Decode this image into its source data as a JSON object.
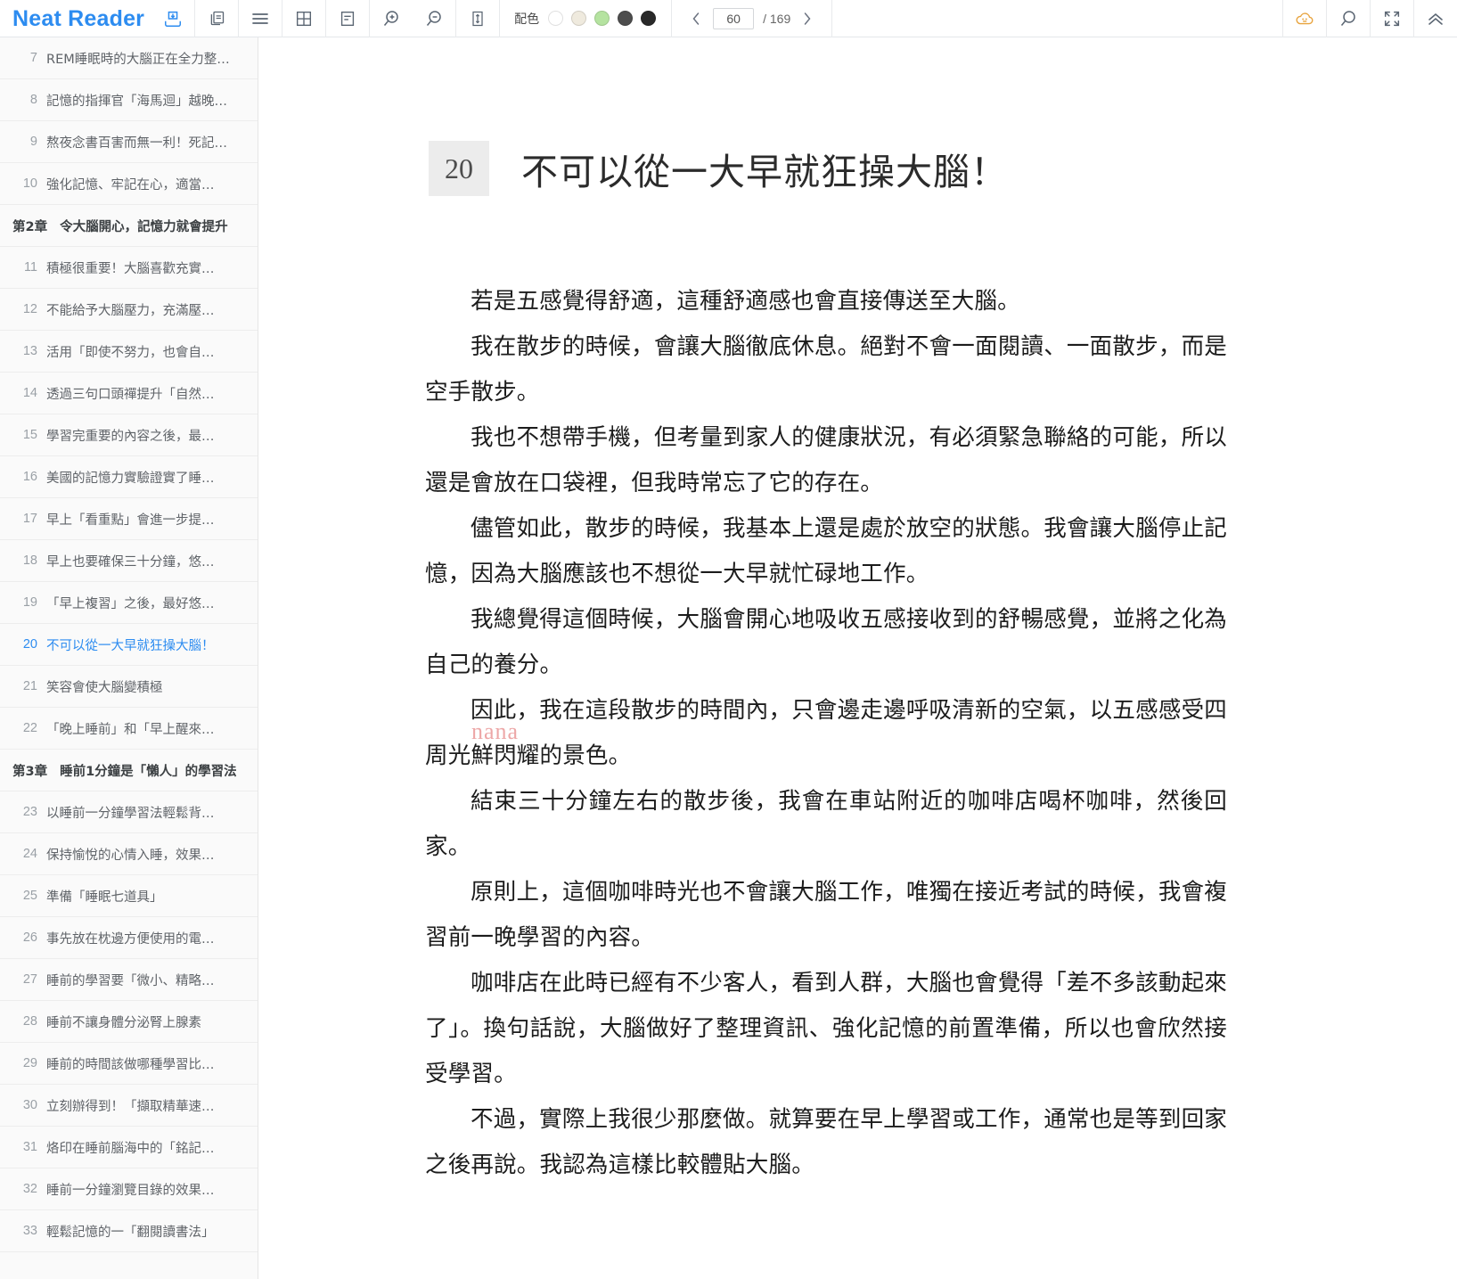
{
  "app": {
    "brand": "Neat Reader"
  },
  "toolbar": {
    "icons": [
      {
        "name": "save-to-bookshelf-icon",
        "title": "保存"
      },
      {
        "name": "copy-icon",
        "title": "複製"
      },
      {
        "name": "menu-icon",
        "title": "目錄"
      },
      {
        "name": "grid-layout-icon",
        "title": "版面"
      },
      {
        "name": "note-icon",
        "title": "筆記"
      },
      {
        "name": "zoom-in-icon",
        "title": "放大"
      },
      {
        "name": "zoom-out-icon",
        "title": "縮小"
      },
      {
        "name": "line-height-icon",
        "title": "行距"
      }
    ],
    "colors_label": "配色",
    "swatches": [
      {
        "name": "theme-white",
        "hex": "#ffffff"
      },
      {
        "name": "theme-cream",
        "hex": "#efeade"
      },
      {
        "name": "theme-green",
        "hex": "#b5e3a0"
      },
      {
        "name": "theme-dark-gray",
        "hex": "#4d4d4d"
      },
      {
        "name": "theme-black",
        "hex": "#292929"
      }
    ],
    "pager": {
      "prev_label": "‹",
      "current_page": "60",
      "total_label": "/ 169"
    },
    "right_icons": [
      {
        "name": "cloud-sync-icon",
        "title": "雲端"
      },
      {
        "name": "search-icon",
        "title": "搜尋"
      },
      {
        "name": "fullscreen-icon",
        "title": "全螢幕"
      },
      {
        "name": "collapse-toolbar-icon",
        "title": "收起"
      }
    ]
  },
  "sidebar": {
    "items": [
      {
        "type": "item",
        "num": "7",
        "label": "REM睡眠時的大腦正在全力整…",
        "active": false
      },
      {
        "type": "item",
        "num": "8",
        "label": "記憶的指揮官「海馬迴」越晚…",
        "active": false
      },
      {
        "type": "item",
        "num": "9",
        "label": "熬夜念書百害而無一利！死記…",
        "active": false
      },
      {
        "type": "item",
        "num": "10",
        "label": "強化記憶、牢記在心，適當…",
        "active": false
      },
      {
        "type": "chapter",
        "num": "第2章",
        "label": "令大腦開心，記憶力就會提升"
      },
      {
        "type": "item",
        "num": "11",
        "label": "積極很重要！大腦喜歡充實…",
        "active": false
      },
      {
        "type": "item",
        "num": "12",
        "label": "不能給予大腦壓力，充滿壓…",
        "active": false
      },
      {
        "type": "item",
        "num": "13",
        "label": "活用「即使不努力，也會自…",
        "active": false
      },
      {
        "type": "item",
        "num": "14",
        "label": "透過三句口頭禪提升「自然…",
        "active": false
      },
      {
        "type": "item",
        "num": "15",
        "label": "學習完重要的內容之後，最…",
        "active": false
      },
      {
        "type": "item",
        "num": "16",
        "label": "美國的記憶力實驗證實了睡…",
        "active": false
      },
      {
        "type": "item",
        "num": "17",
        "label": "早上「看重點」會進一步提…",
        "active": false
      },
      {
        "type": "item",
        "num": "18",
        "label": "早上也要確保三十分鐘，悠…",
        "active": false
      },
      {
        "type": "item",
        "num": "19",
        "label": "「早上複習」之後，最好悠…",
        "active": false
      },
      {
        "type": "item",
        "num": "20",
        "label": "不可以從一大早就狂操大腦！",
        "active": true
      },
      {
        "type": "item",
        "num": "21",
        "label": "笑容會使大腦變積極",
        "active": false
      },
      {
        "type": "item",
        "num": "22",
        "label": "「晚上睡前」和「早上醒來…",
        "active": false
      },
      {
        "type": "chapter",
        "num": "第3章",
        "label": "睡前1分鐘是「懶人」的學習法"
      },
      {
        "type": "item",
        "num": "23",
        "label": "以睡前一分鐘學習法輕鬆背…",
        "active": false
      },
      {
        "type": "item",
        "num": "24",
        "label": "保持愉悅的心情入睡，效果…",
        "active": false
      },
      {
        "type": "item",
        "num": "25",
        "label": "準備「睡眠七道具」",
        "active": false
      },
      {
        "type": "item",
        "num": "26",
        "label": "事先放在枕邊方便使用的電…",
        "active": false
      },
      {
        "type": "item",
        "num": "27",
        "label": "睡前的學習要「微小、精略…",
        "active": false
      },
      {
        "type": "item",
        "num": "28",
        "label": "睡前不讓身體分泌腎上腺素",
        "active": false
      },
      {
        "type": "item",
        "num": "29",
        "label": "睡前的時間該做哪種學習比…",
        "active": false
      },
      {
        "type": "item",
        "num": "30",
        "label": "立刻辦得到！「擷取精華速…",
        "active": false
      },
      {
        "type": "item",
        "num": "31",
        "label": "烙印在睡前腦海中的「銘記…",
        "active": false
      },
      {
        "type": "item",
        "num": "32",
        "label": "睡前一分鐘瀏覽目錄的效果…",
        "active": false
      },
      {
        "type": "item",
        "num": "33",
        "label": "輕鬆記憶的一「翻閱讀書法」",
        "active": false
      }
    ]
  },
  "content": {
    "section_number": "20",
    "section_title": "不可以從一大早就狂操大腦！",
    "watermark": "nana",
    "paragraphs": [
      "若是五感覺得舒適，這種舒適感也會直接傳送至大腦。",
      "我在散步的時候，會讓大腦徹底休息。絕對不會一面閱讀、一面散步，而是空手散步。",
      "我也不想帶手機，但考量到家人的健康狀況，有必須緊急聯絡的可能，所以還是會放在口袋裡，但我時常忘了它的存在。",
      "儘管如此，散步的時候，我基本上還是處於放空的狀態。我會讓大腦停止記憶，因為大腦應該也不想從一大早就忙碌地工作。",
      "我總覺得這個時候，大腦會開心地吸收五感接收到的舒暢感覺，並將之化為自己的養分。",
      "因此，我在這段散步的時間內，只會邊走邊呼吸清新的空氣，以五感感受四周光鮮閃耀的景色。",
      "結束三十分鐘左右的散步後，我會在車站附近的咖啡店喝杯咖啡，然後回家。",
      "原則上，這個咖啡時光也不會讓大腦工作，唯獨在接近考試的時候，我會複習前一晚學習的內容。",
      "咖啡店在此時已經有不少客人，看到人群，大腦也會覺得「差不多該動起來了」。換句話說，大腦做好了整理資訊、強化記憶的前置準備，所以也會欣然接受學習。",
      "不過，實際上我很少那麼做。就算要在早上學習或工作，通常也是等到回家之後再說。我認為這樣比較體貼大腦。"
    ]
  }
}
